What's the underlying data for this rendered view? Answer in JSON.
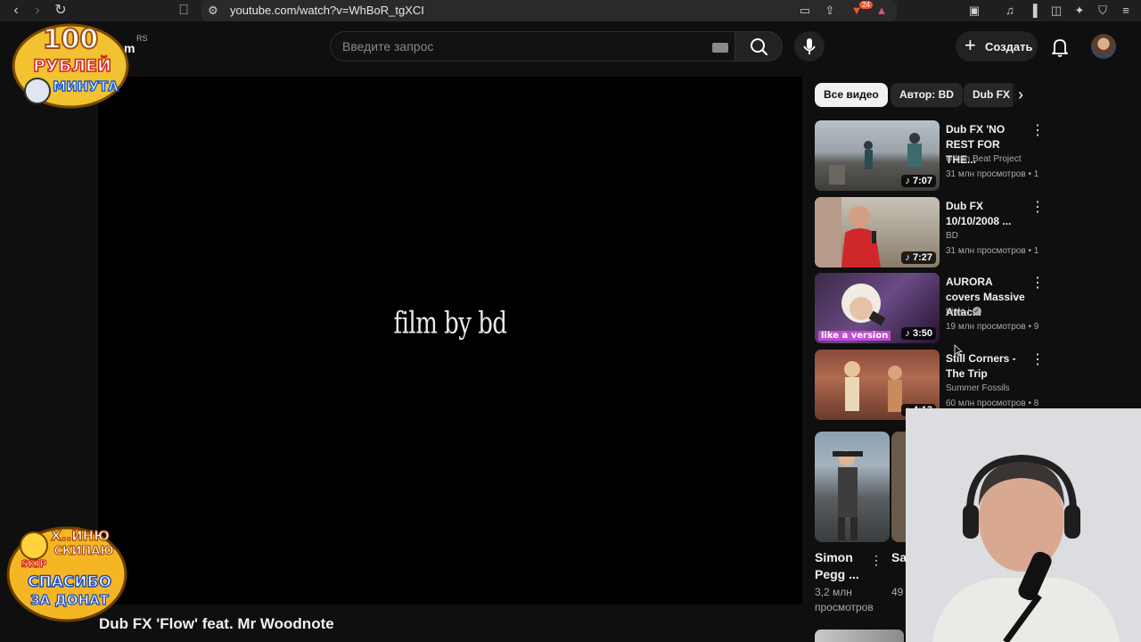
{
  "browser": {
    "url": "youtube.com/watch?v=WhBoR_tgXCI",
    "extension_badge": "24"
  },
  "header": {
    "region_code": "RS",
    "logo_fragment": "m",
    "search_placeholder": "Введите запрос",
    "create_label": "Создать"
  },
  "player": {
    "frame_text": "film by bd"
  },
  "video": {
    "title": "Dub FX 'Flow' feat. Mr Woodnote"
  },
  "chips": [
    {
      "label": "Все видео",
      "active": true
    },
    {
      "label": "Автор: BD",
      "active": false
    },
    {
      "label": "Dub FX",
      "active": false
    }
  ],
  "recommendations": [
    {
      "title": "Dub FX 'NO REST FOR THE...",
      "channel": "Urban Beat Project",
      "stats": "31 млн просмотров • 1",
      "duration": "7:07",
      "verified": false
    },
    {
      "title": "Dub FX 10/10/2008 ...",
      "channel": "BD",
      "stats": "31 млн просмотров • 1",
      "duration": "7:27",
      "verified": false
    },
    {
      "title": "AURORA covers Massive Attac...",
      "channel": "triple j",
      "stats": "19 млн просмотров • 9",
      "duration": "3:50",
      "verified": true,
      "thumb_text": "like a version"
    },
    {
      "title": "Still Corners - The Trip",
      "channel": "Summer Fossils",
      "stats": "60 млн просмотров • 8",
      "duration": "4:13",
      "verified": false
    }
  ],
  "shorts": [
    {
      "title": "Simon Pegg ...",
      "views": "3,2 млн просмотров"
    },
    {
      "title": "Sa... Bla...",
      "views": "49 ... про..."
    }
  ],
  "stream_overlays": {
    "top_badge_lines": [
      "100",
      "РУБЛЕЙ",
      "МИНУТА"
    ],
    "bottom_badge_lines": [
      "Х..ЙНЮ",
      "СКИПАЮ",
      "SKIP",
      "СПАСИБО",
      "ЗА ДОНАТ"
    ]
  },
  "colors": {
    "page_bg": "#0f0f0f",
    "chip_active": "#f1f1f1",
    "secondary_text": "#aaaaaa"
  }
}
